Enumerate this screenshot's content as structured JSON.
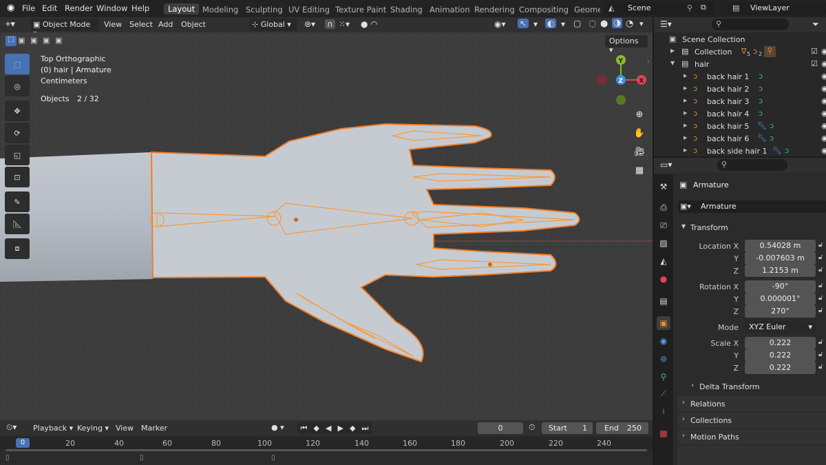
{
  "topbar": {
    "menus": [
      "File",
      "Edit",
      "Render",
      "Window",
      "Help"
    ],
    "workspaces": [
      "Layout",
      "Modeling",
      "Sculpting",
      "UV Editing",
      "Texture Paint",
      "Shading",
      "Animation",
      "Rendering",
      "Compositing",
      "Geomet"
    ],
    "active_workspace": "Layout",
    "scene_label": "Scene",
    "viewlayer_label": "ViewLayer"
  },
  "viewport_header": {
    "mode": "Object Mode",
    "menus": [
      "View",
      "Select",
      "Add",
      "Object"
    ],
    "transform_orientation": "Global",
    "options_label": "Options"
  },
  "overlay": {
    "view_name": "Top Orthographic",
    "object_info": "(0) hair | Armature",
    "units": "Centimeters",
    "objects_label": "Objects",
    "objects_count": "2 / 32"
  },
  "gizmo": {
    "y": "Y",
    "z": "Z",
    "x": "X"
  },
  "timeline": {
    "menus": [
      "Playback",
      "Keying",
      "View",
      "Marker"
    ],
    "current_frame": "0",
    "start_label": "Start",
    "start_value": "1",
    "end_label": "End",
    "end_value": "250",
    "ruler_ticks": [
      "0",
      "20",
      "40",
      "60",
      "80",
      "100",
      "120",
      "140",
      "160",
      "180",
      "200",
      "220",
      "240"
    ]
  },
  "outliner": {
    "scene_collection": "Scene Collection",
    "collection": "Collection",
    "collection_counts": [
      "5",
      "2"
    ],
    "hair": "hair",
    "items": [
      "back hair 1",
      "back hair 2",
      "back hair 3",
      "back hair 4",
      "back hair 5",
      "back hair 6",
      "back side hair 1"
    ]
  },
  "properties": {
    "object_name": "Armature",
    "data_name": "Armature",
    "transform_label": "Transform",
    "location_label": "Location X",
    "location": [
      "0.54028 m",
      "-0.007603 m",
      "1.2153 m"
    ],
    "rotation_label": "Rotation X",
    "rotation": [
      "-90°",
      "0.000001°",
      "270°"
    ],
    "mode_label": "Mode",
    "mode_value": "XYZ Euler",
    "scale_label": "Scale X",
    "scale": [
      "0.222",
      "0.222",
      "0.222"
    ],
    "axis_y": "Y",
    "axis_z": "Z",
    "delta_transform": "Delta Transform",
    "relations": "Relations",
    "collections": "Collections",
    "motion_paths": "Motion Paths"
  },
  "colors": {
    "selection_orange": "#f27d26",
    "active_blue": "#4772b3",
    "axis_x": "#e2435a",
    "axis_y": "#8bb830",
    "axis_z": "#3c8ee3"
  }
}
